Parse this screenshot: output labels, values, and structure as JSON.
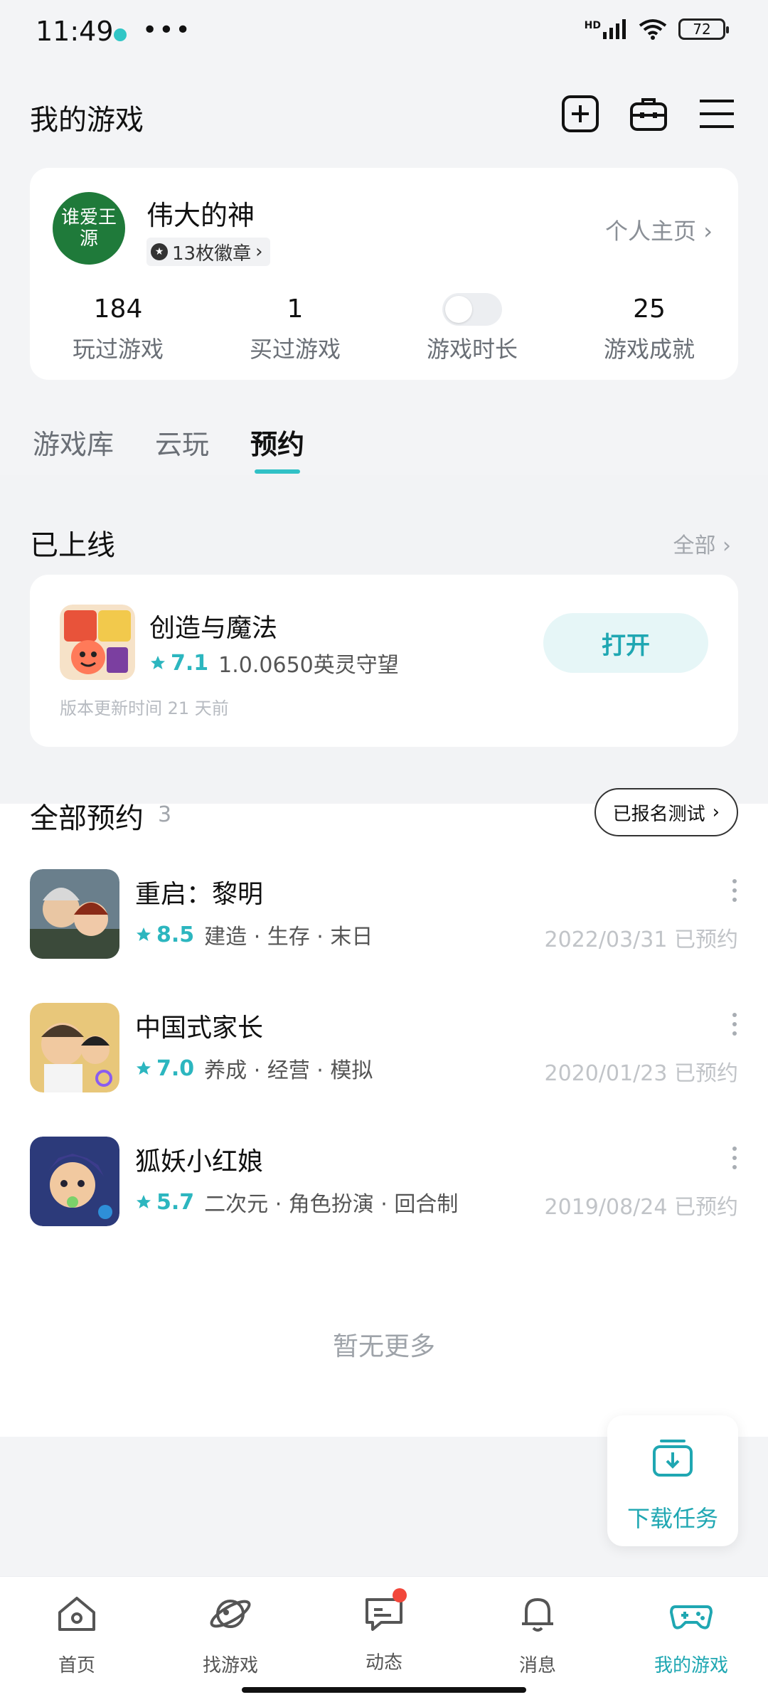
{
  "status_bar": {
    "time": "11:49",
    "more": "•••",
    "hd": "HD",
    "battery": "72"
  },
  "header": {
    "title": "我的游戏"
  },
  "profile": {
    "username": "伟大的神",
    "avatar_text": "谁爱王源",
    "badges": "13枚徽章",
    "homepage_link": "个人主页",
    "stats": [
      {
        "value": "184",
        "label": "玩过游戏"
      },
      {
        "value": "1",
        "label": "买过游戏"
      },
      {
        "value": "",
        "label": "游戏时长"
      },
      {
        "value": "25",
        "label": "游戏成就"
      }
    ]
  },
  "tabs": [
    "游戏库",
    "云玩",
    "预约"
  ],
  "active_tab": "预约",
  "online_section": {
    "title": "已上线",
    "see_all": "全部",
    "game": {
      "name": "创造与魔法",
      "rating": "7.1",
      "version": "1.0.0650英灵守望",
      "update_note": "版本更新时间 21 天前",
      "button": "打开"
    }
  },
  "reservations": {
    "title": "全部预约",
    "count": "3",
    "signed_button": "已报名测试",
    "items": [
      {
        "name": "重启：黎明",
        "rating": "8.5",
        "tags": "建造 · 生存 · 末日",
        "date": "2022/03/31 已预约"
      },
      {
        "name": "中国式家长",
        "rating": "7.0",
        "tags": "养成 · 经营 · 模拟",
        "date": "2020/01/23 已预约"
      },
      {
        "name": "狐妖小红娘",
        "rating": "5.7",
        "tags": "二次元 · 角色扮演 · 回合制",
        "date": "2019/08/24 已预约"
      }
    ],
    "no_more": "暂无更多"
  },
  "float_download": {
    "label": "下载任务"
  },
  "bottom_nav": [
    {
      "label": "首页",
      "icon": "home-icon"
    },
    {
      "label": "找游戏",
      "icon": "planet-icon"
    },
    {
      "label": "动态",
      "icon": "chat-icon"
    },
    {
      "label": "消息",
      "icon": "bell-icon"
    },
    {
      "label": "我的游戏",
      "icon": "gamepad-icon"
    }
  ],
  "colors": {
    "accent": "#1fa7b2",
    "rating": "#2cb6bf",
    "notification": "#f2473b"
  }
}
